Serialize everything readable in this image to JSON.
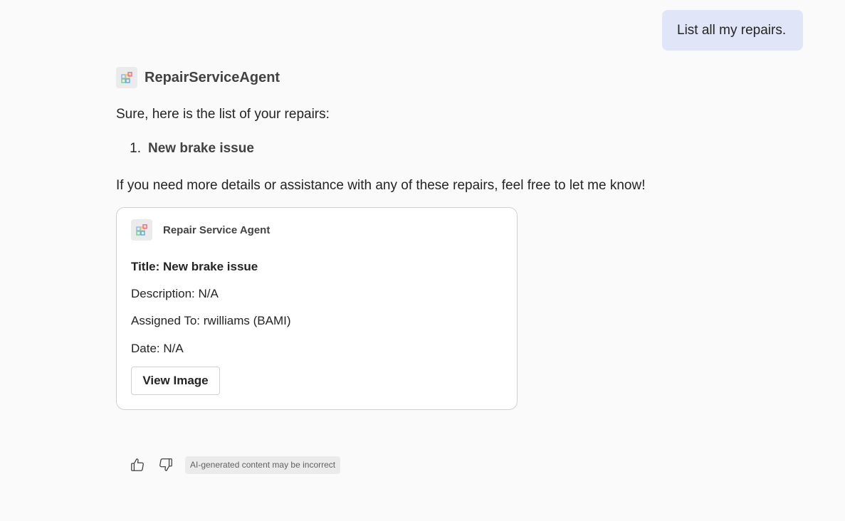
{
  "user_message": {
    "text": "List all my repairs."
  },
  "agent": {
    "name": "RepairServiceAgent",
    "icon": "app-tiles-icon"
  },
  "response": {
    "intro": "Sure, here is the list of your repairs:",
    "repairs": [
      {
        "number": "1.",
        "title": "New brake issue"
      }
    ],
    "outro": "If you need more details or assistance with any of these repairs, feel free to let me know!"
  },
  "card": {
    "agent_name": "Repair Service Agent",
    "title_line": "Title: New brake issue",
    "description_line": "Description: N/A",
    "assigned_line": "Assigned To: rwilliams (BAMI)",
    "date_line": "Date: N/A",
    "button_label": "View Image"
  },
  "feedback": {
    "like_icon": "thumbs-up-icon",
    "dislike_icon": "thumbs-down-icon",
    "disclaimer": "AI-generated content may be incorrect"
  },
  "colors": {
    "user_bubble": "#e1e5f8",
    "background": "#fafafa",
    "card_border": "#d1d1d1"
  }
}
